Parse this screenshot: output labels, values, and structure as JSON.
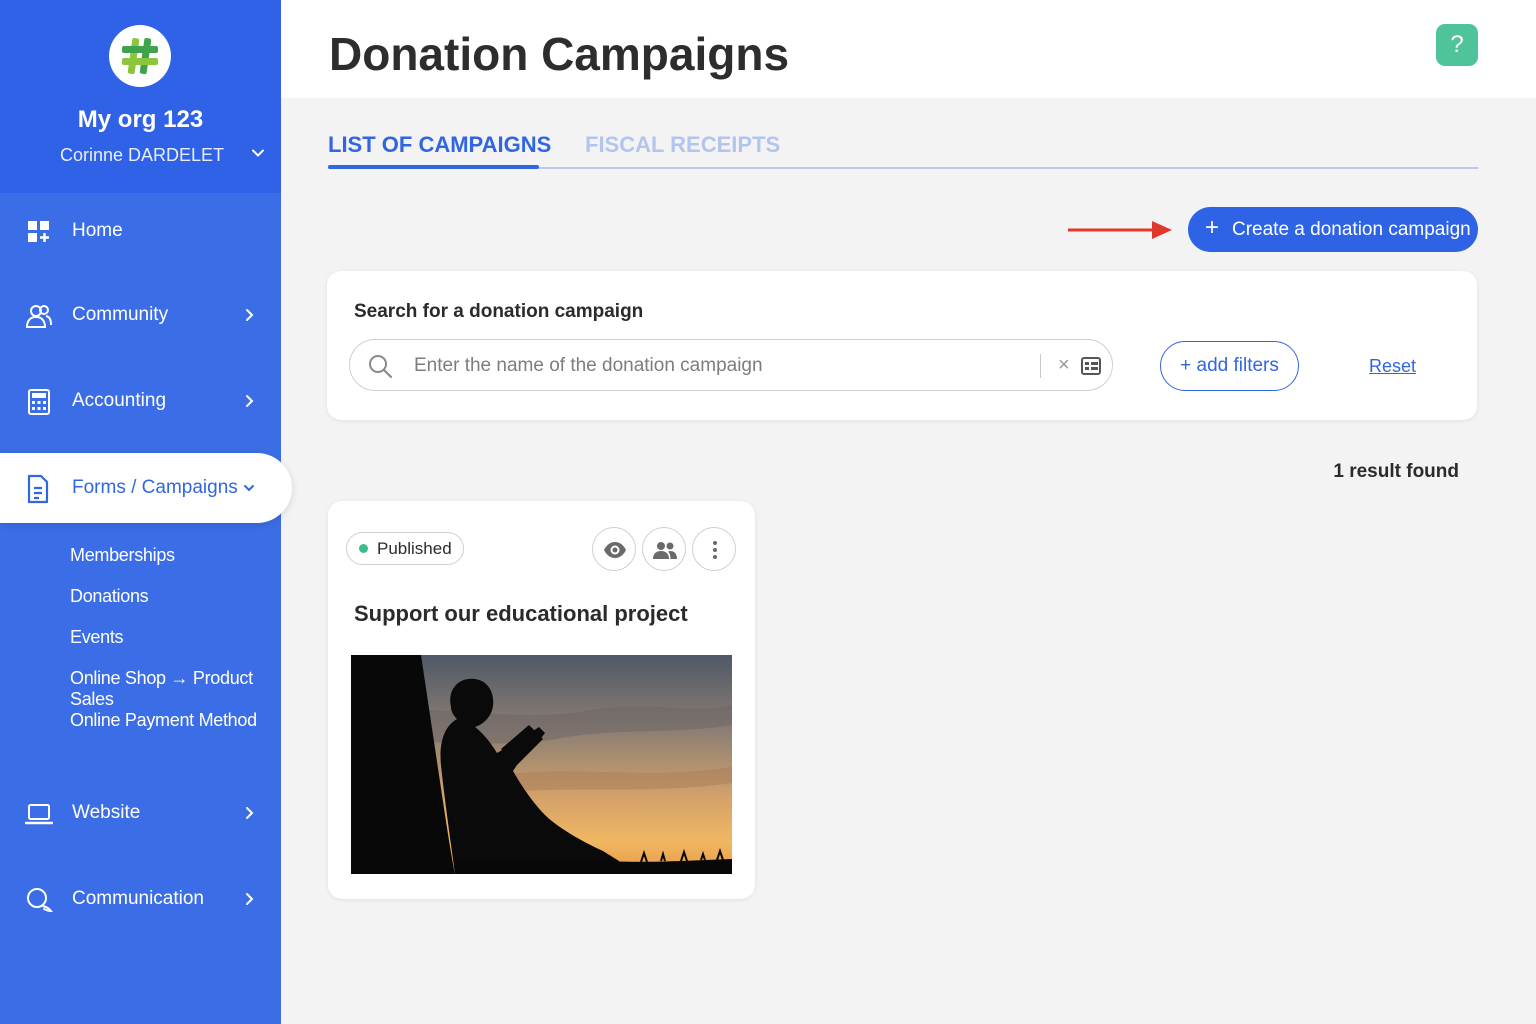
{
  "sidebar": {
    "org_name": "My org 123",
    "user_name": "Corinne DARDELET",
    "items": [
      {
        "label": "Home",
        "icon": "dashboard-icon"
      },
      {
        "label": "Community",
        "icon": "users-icon"
      },
      {
        "label": "Accounting",
        "icon": "calculator-icon"
      },
      {
        "label": "Forms / Campaigns",
        "icon": "document-icon"
      },
      {
        "label": "Website",
        "icon": "laptop-icon"
      },
      {
        "label": "Communication",
        "icon": "chat-icon"
      }
    ],
    "subitems": [
      "Memberships",
      "Donations",
      "Events",
      "Online Shop → Product Sales",
      "Online Payment Method"
    ]
  },
  "header": {
    "title": "Donation Campaigns",
    "help_label": "?"
  },
  "tabs": [
    {
      "label": "LIST OF CAMPAIGNS",
      "active": true
    },
    {
      "label": "FISCAL RECEIPTS",
      "active": false
    }
  ],
  "actions": {
    "create_label": "Create a donation campaign"
  },
  "search": {
    "heading": "Search for a donation campaign",
    "placeholder": "Enter the name of the donation campaign",
    "filters_label": "+ add filters",
    "reset_label": "Reset"
  },
  "results": {
    "count_label": "1 result found"
  },
  "campaign": {
    "status": "Published",
    "title": "Support our educational project"
  },
  "colors": {
    "sidebar": "#3b6ee6",
    "accent": "#3166e3",
    "help": "#4fc49b",
    "published": "#3dbb8a",
    "arrow": "#e0382b"
  }
}
